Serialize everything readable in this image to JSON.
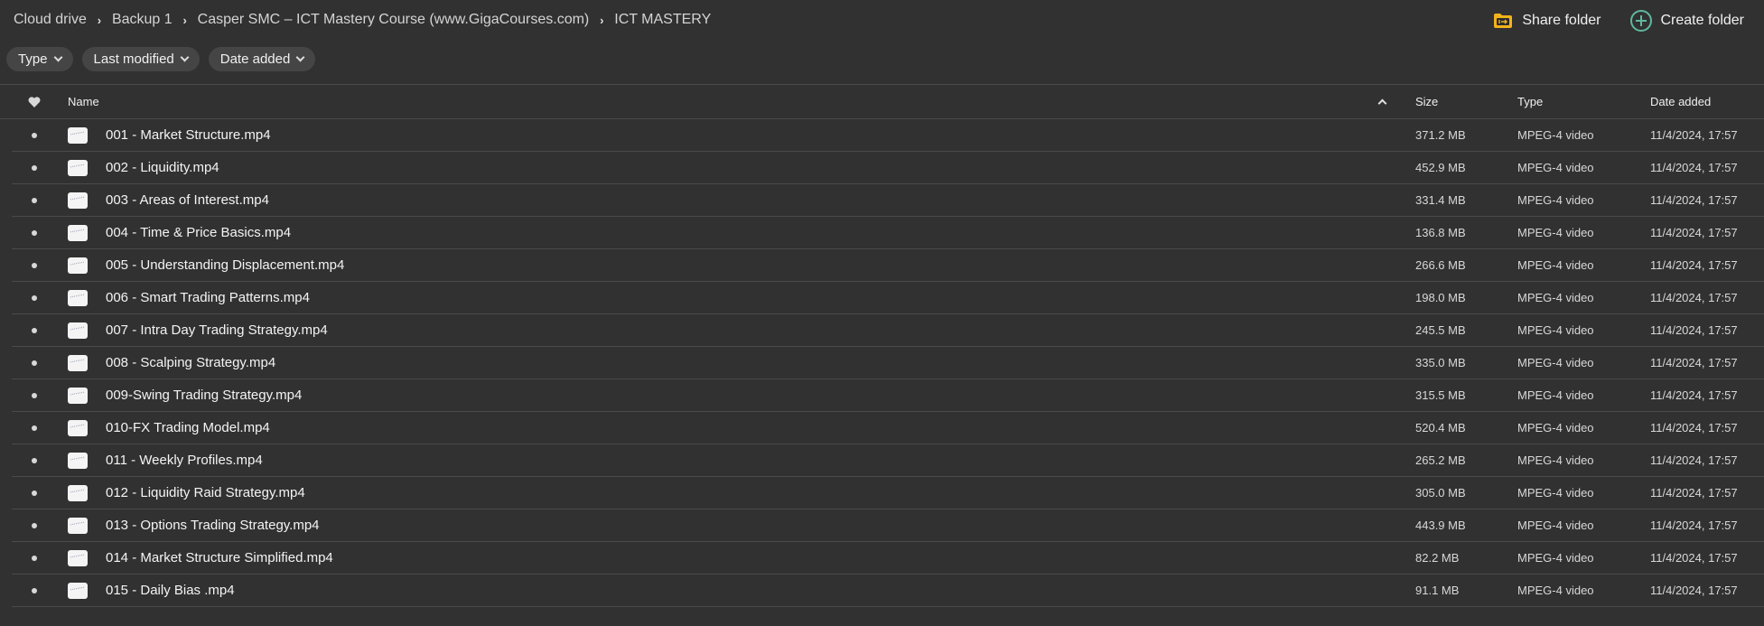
{
  "breadcrumb": [
    {
      "label": "Cloud drive"
    },
    {
      "label": "Backup 1"
    },
    {
      "label": "Casper SMC – ICT Mastery Course (www.GigaCourses.com)"
    },
    {
      "label": "ICT MASTERY"
    }
  ],
  "actions": {
    "share_folder": "Share folder",
    "create_folder": "Create folder"
  },
  "colors": {
    "share_icon": "#f2b21b",
    "create_icon": "#5fb8a0",
    "background": "#313131"
  },
  "filters": [
    {
      "label": "Type"
    },
    {
      "label": "Last modified"
    },
    {
      "label": "Date added"
    }
  ],
  "table": {
    "columns": {
      "favorite": "heart-icon",
      "name": "Name",
      "size": "Size",
      "type": "Type",
      "date_added": "Date added"
    },
    "sort": {
      "column": "name",
      "direction": "ascending"
    },
    "rows": [
      {
        "name": "001 - Market Structure.mp4",
        "size": "371.2 MB",
        "type": "MPEG-4 video",
        "date_added": "11/4/2024, 17:57"
      },
      {
        "name": "002 - Liquidity.mp4",
        "size": "452.9 MB",
        "type": "MPEG-4 video",
        "date_added": "11/4/2024, 17:57"
      },
      {
        "name": "003 - Areas of Interest.mp4",
        "size": "331.4 MB",
        "type": "MPEG-4 video",
        "date_added": "11/4/2024, 17:57"
      },
      {
        "name": "004 - Time & Price Basics.mp4",
        "size": "136.8 MB",
        "type": "MPEG-4 video",
        "date_added": "11/4/2024, 17:57"
      },
      {
        "name": "005 - Understanding Displacement.mp4",
        "size": "266.6 MB",
        "type": "MPEG-4 video",
        "date_added": "11/4/2024, 17:57"
      },
      {
        "name": "006 - Smart Trading Patterns.mp4",
        "size": "198.0 MB",
        "type": "MPEG-4 video",
        "date_added": "11/4/2024, 17:57"
      },
      {
        "name": "007 - Intra Day Trading Strategy.mp4",
        "size": "245.5 MB",
        "type": "MPEG-4 video",
        "date_added": "11/4/2024, 17:57"
      },
      {
        "name": "008 - Scalping Strategy.mp4",
        "size": "335.0 MB",
        "type": "MPEG-4 video",
        "date_added": "11/4/2024, 17:57"
      },
      {
        "name": "009-Swing Trading Strategy.mp4",
        "size": "315.5 MB",
        "type": "MPEG-4 video",
        "date_added": "11/4/2024, 17:57"
      },
      {
        "name": "010-FX Trading Model.mp4",
        "size": "520.4 MB",
        "type": "MPEG-4 video",
        "date_added": "11/4/2024, 17:57"
      },
      {
        "name": "011 - Weekly Profiles.mp4",
        "size": "265.2 MB",
        "type": "MPEG-4 video",
        "date_added": "11/4/2024, 17:57"
      },
      {
        "name": "012 - Liquidity Raid Strategy.mp4",
        "size": "305.0 MB",
        "type": "MPEG-4 video",
        "date_added": "11/4/2024, 17:57"
      },
      {
        "name": "013 - Options Trading Strategy.mp4",
        "size": "443.9 MB",
        "type": "MPEG-4 video",
        "date_added": "11/4/2024, 17:57"
      },
      {
        "name": "014 - Market Structure Simplified.mp4",
        "size": "82.2 MB",
        "type": "MPEG-4 video",
        "date_added": "11/4/2024, 17:57"
      },
      {
        "name": "015 - Daily Bias .mp4",
        "size": "91.1 MB",
        "type": "MPEG-4 video",
        "date_added": "11/4/2024, 17:57"
      }
    ]
  }
}
